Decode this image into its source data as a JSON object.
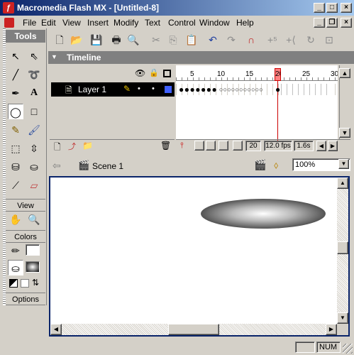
{
  "titlebar": {
    "title": "Macromedia Flash MX - [Untitled-8]",
    "icon": "flash-app-icon"
  },
  "menu": {
    "items": [
      "File",
      "Edit",
      "View",
      "Insert",
      "Modify",
      "Text",
      "Control",
      "Window",
      "Help"
    ]
  },
  "tools": {
    "title": "Tools",
    "view_label": "View",
    "colors_label": "Colors",
    "options_label": "Options"
  },
  "timeline": {
    "title": "Timeline",
    "layer_name": "Layer 1",
    "ruler": [
      "5",
      "10",
      "15",
      "20",
      "25",
      "30"
    ],
    "current_frame": "20",
    "frame_rate": "12.0 fps",
    "elapsed": "1.6s"
  },
  "stagebar": {
    "scene": "Scene 1",
    "zoom": "100%"
  },
  "status": {
    "num": "NUM"
  },
  "colors": {
    "titlebar_start": "#0a246a",
    "titlebar_end": "#a6caf0",
    "playhead": "#cc0000",
    "stage_border": "#0a246a"
  }
}
